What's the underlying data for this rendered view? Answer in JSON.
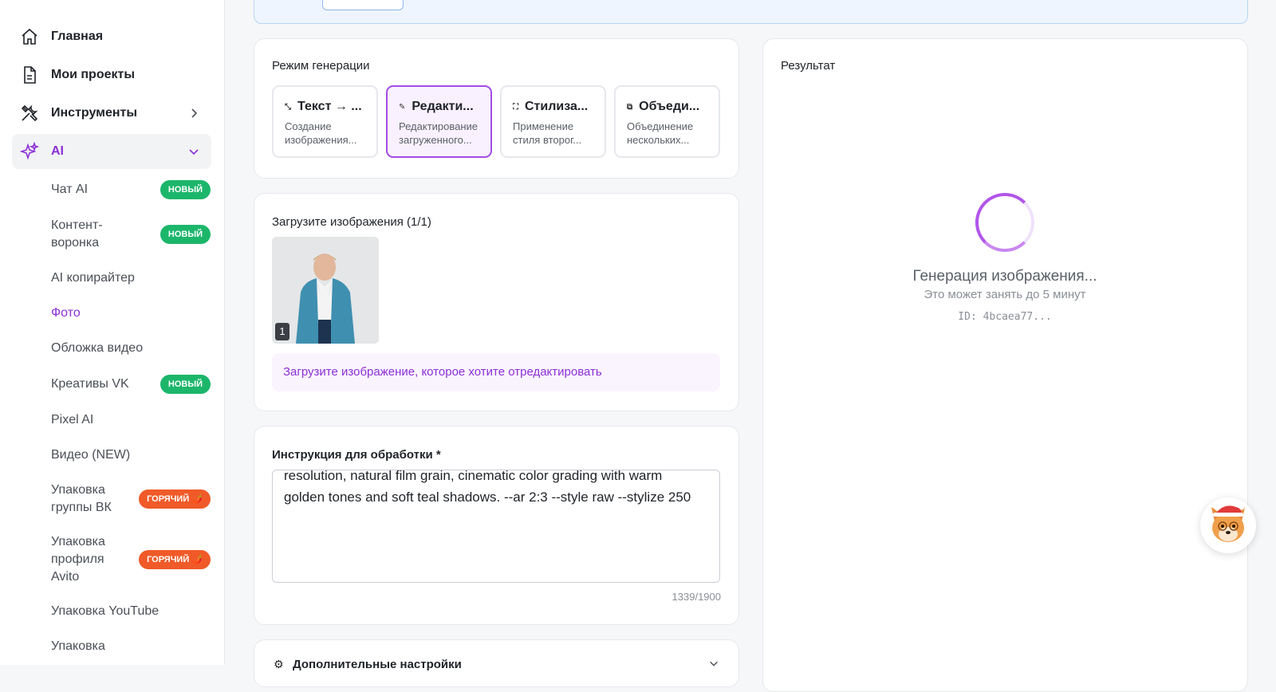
{
  "sidebar": {
    "main": [
      {
        "label": "Главная",
        "icon": "home-icon"
      },
      {
        "label": "Мои проекты",
        "icon": "document-icon"
      },
      {
        "label": "Инструменты",
        "icon": "tools-icon"
      },
      {
        "label": "AI",
        "icon": "sparkles-icon"
      }
    ],
    "sub": [
      {
        "label": "Чат AI",
        "badge": "НОВЫЙ"
      },
      {
        "label": "Контент-воронка",
        "badge": "НОВЫЙ"
      },
      {
        "label": "AI копирайтер"
      },
      {
        "label": "Фото"
      },
      {
        "label": "Обложка видео"
      },
      {
        "label": "Креативы VK",
        "badge": "НОВЫЙ"
      },
      {
        "label": "Pixel AI"
      },
      {
        "label": "Видео (NEW)"
      },
      {
        "label": "Упаковка группы ВК",
        "badge": "ГОРЯЧИЙ 🌶️"
      },
      {
        "label": "Упаковка профиля Avito",
        "badge": "ГОРЯЧИЙ 🌶️"
      },
      {
        "label": "Упаковка YouTube"
      },
      {
        "label": "Упаковка"
      }
    ]
  },
  "mode_card": {
    "title": "Режим генерации",
    "modes": [
      {
        "title": "Текст → ...",
        "desc": "Создание изображения...",
        "icon": "shrink-icon"
      },
      {
        "title": "Редакти...",
        "desc": "Редактирование загруженного...",
        "icon": "pencil-icon"
      },
      {
        "title": "Стилиза...",
        "desc": "Применение стиля второг...",
        "icon": "expand-icon"
      },
      {
        "title": "Объеди...",
        "desc": "Объединение нескольких...",
        "icon": "copy-icon"
      }
    ]
  },
  "upload_card": {
    "title": "Загрузите изображения (1/1)",
    "thumb_number": "1",
    "hint": "Загрузите изображение, которое хотите отредактировать"
  },
  "instruction_card": {
    "title": "Инструкция для обработки *",
    "text": "resolution, natural film grain, cinematic color grading with warm golden tones and soft teal shadows. --ar 2:3 --style raw --stylize 250",
    "counter": "1339/1900"
  },
  "settings_card": {
    "title": "Дополнительные настройки"
  },
  "result_card": {
    "title": "Результат",
    "status": "Генерация изображения...",
    "sub": "Это может занять до 5 минут",
    "id": "ID: 4bcaea77..."
  },
  "colors": {
    "accent": "#8b2fd6",
    "badge_new": "#1cb66b",
    "badge_hot": "#f05a28"
  }
}
